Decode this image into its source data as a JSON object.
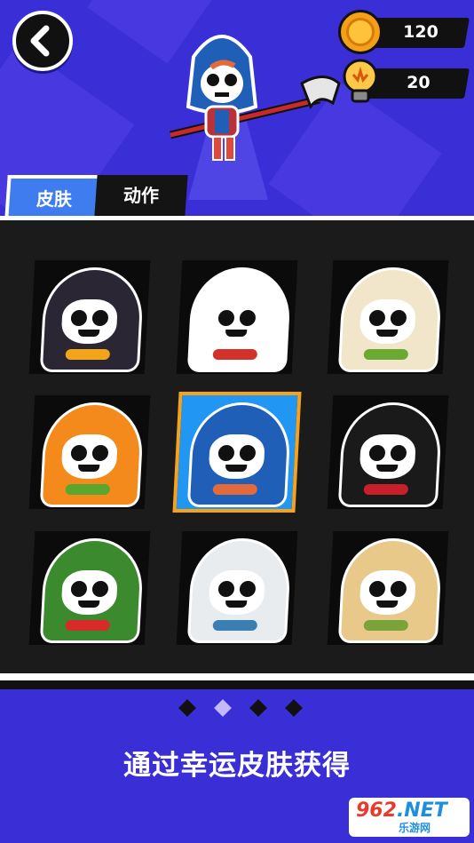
{
  "header": {
    "coins": "120",
    "bulbs": "20",
    "back_icon": "back-arrow-icon"
  },
  "tabs": [
    {
      "label": "皮肤",
      "active": true
    },
    {
      "label": "动作",
      "active": false
    }
  ],
  "skins": [
    {
      "name": "black-cat",
      "hood": "#2b2634",
      "accent": "#f3a51a"
    },
    {
      "name": "fox-mask",
      "hood": "#ffffff",
      "accent": "#d2322a"
    },
    {
      "name": "llama",
      "hood": "#f1e6c9",
      "accent": "#6aa932"
    },
    {
      "name": "pumpkin",
      "hood": "#f38a1b",
      "accent": "#5aa72e"
    },
    {
      "name": "chucky",
      "hood": "#1f5fb8",
      "accent": "#e26a3b",
      "selected": true
    },
    {
      "name": "vampire",
      "hood": "#1a1a1a",
      "accent": "#c8202a"
    },
    {
      "name": "clown",
      "hood": "#3b8a2d",
      "accent": "#d92a2a"
    },
    {
      "name": "astronaut",
      "hood": "#e9ecef",
      "accent": "#3a7fb3"
    },
    {
      "name": "mummy",
      "hood": "#e8c98a",
      "accent": "#7aa43a"
    }
  ],
  "pager": {
    "count": 4,
    "active": 1
  },
  "caption": "通过幸运皮肤获得",
  "watermark": {
    "main_a": "962",
    "main_b": ".NET",
    "sub": "乐游网"
  }
}
